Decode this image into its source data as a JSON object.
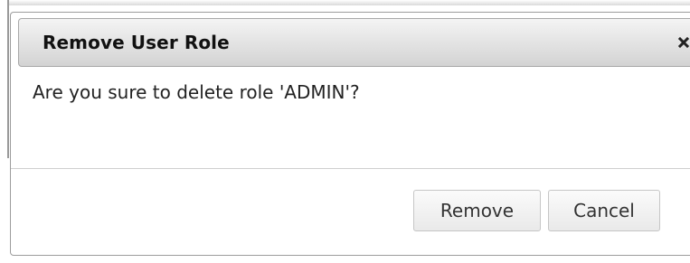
{
  "dialog": {
    "title": "Remove User Role",
    "close_icon": "close-icon",
    "message": "Are you sure to delete role 'ADMIN'?",
    "buttons": {
      "remove_label": "Remove",
      "cancel_label": "Cancel"
    }
  },
  "colors": {
    "titlebar_top": "#f4f4f4",
    "titlebar_bottom": "#d3d3d3",
    "border": "#9c9c9c",
    "button_bg": "#efefef",
    "text": "#222222"
  }
}
